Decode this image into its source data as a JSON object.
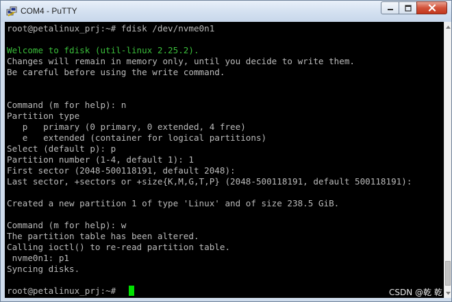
{
  "window": {
    "title": "COM4 - PuTTY"
  },
  "terminal": {
    "lines": [
      {
        "text": "root@petalinux_prj:~# fdisk /dev/nvme0n1",
        "color": "#bbbbbb"
      },
      {
        "text": "",
        "color": "#bbbbbb"
      },
      {
        "text": "Welcome to fdisk (util-linux 2.25.2).",
        "color": "#3bbf3b"
      },
      {
        "text": "Changes will remain in memory only, until you decide to write them.",
        "color": "#bbbbbb"
      },
      {
        "text": "Be careful before using the write command.",
        "color": "#bbbbbb"
      },
      {
        "text": "",
        "color": "#bbbbbb"
      },
      {
        "text": "",
        "color": "#bbbbbb"
      },
      {
        "text": "Command (m for help): n",
        "color": "#bbbbbb"
      },
      {
        "text": "Partition type",
        "color": "#bbbbbb"
      },
      {
        "text": "   p   primary (0 primary, 0 extended, 4 free)",
        "color": "#bbbbbb"
      },
      {
        "text": "   e   extended (container for logical partitions)",
        "color": "#bbbbbb"
      },
      {
        "text": "Select (default p): p",
        "color": "#bbbbbb"
      },
      {
        "text": "Partition number (1-4, default 1): 1",
        "color": "#bbbbbb"
      },
      {
        "text": "First sector (2048-500118191, default 2048):",
        "color": "#bbbbbb"
      },
      {
        "text": "Last sector, +sectors or +size{K,M,G,T,P} (2048-500118191, default 500118191):",
        "color": "#bbbbbb"
      },
      {
        "text": "",
        "color": "#bbbbbb"
      },
      {
        "text": "Created a new partition 1 of type 'Linux' and of size 238.5 GiB.",
        "color": "#bbbbbb"
      },
      {
        "text": "",
        "color": "#bbbbbb"
      },
      {
        "text": "Command (m for help): w",
        "color": "#bbbbbb"
      },
      {
        "text": "The partition table has been altered.",
        "color": "#bbbbbb"
      },
      {
        "text": "Calling ioctl() to re-read partition table.",
        "color": "#bbbbbb"
      },
      {
        "text": " nvme0n1: p1",
        "color": "#bbbbbb"
      },
      {
        "text": "Syncing disks.",
        "color": "#bbbbbb"
      },
      {
        "text": "",
        "color": "#bbbbbb"
      },
      {
        "text": "root@petalinux_prj:~# ",
        "color": "#bbbbbb"
      }
    ],
    "cursor_color": "#00e000"
  },
  "watermark": {
    "text": "CSDN @乾 乾"
  }
}
